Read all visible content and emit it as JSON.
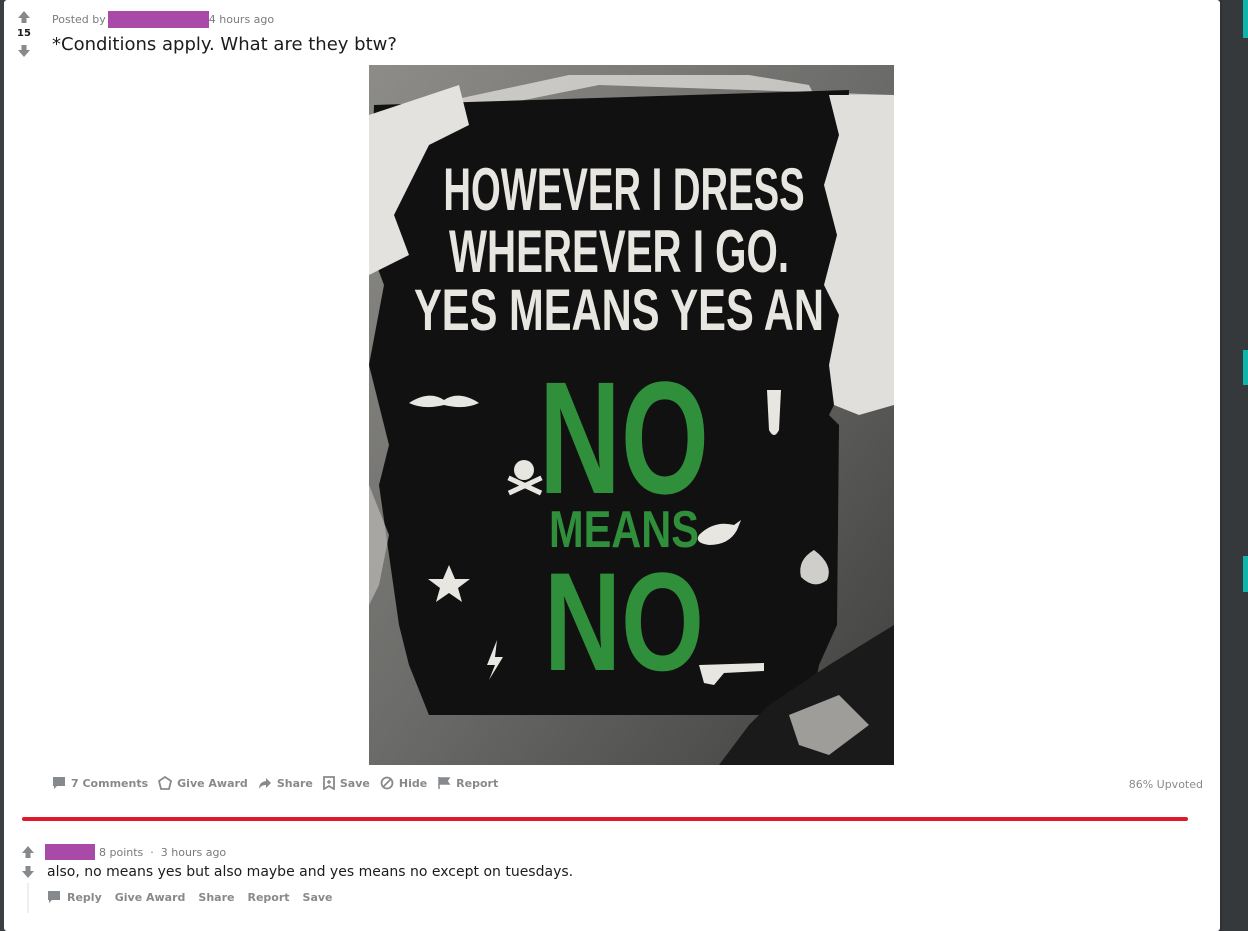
{
  "post": {
    "score": "15",
    "posted_by_prefix": "Posted by",
    "time": "4 hours ago",
    "title": "*Conditions apply. What are they btw?",
    "image": {
      "lines": [
        "HOWEVER I DRESS",
        "WHEREVER I GO.",
        "YES MEANS YES AN",
        "NO",
        "MEANS",
        "NO"
      ]
    },
    "actions": {
      "comments": "7 Comments",
      "give_award": "Give Award",
      "share": "Share",
      "save": "Save",
      "hide": "Hide",
      "report": "Report"
    },
    "upvoted": "86% Upvoted"
  },
  "comment": {
    "points": "8 points",
    "separator": "·",
    "time": "3 hours ago",
    "body": "also, no means yes but also maybe and yes means no except on tuesdays.",
    "actions": {
      "reply": "Reply",
      "give_award": "Give Award",
      "share": "Share",
      "report": "Report",
      "save": "Save"
    }
  },
  "colors": {
    "redaction": "#a94aa8",
    "separator_line": "#e0182b",
    "poster_green": "#2f8f3a",
    "teal_accent": "#0fb5aa"
  },
  "icons": [
    "upvote-icon",
    "downvote-icon",
    "comment-icon",
    "award-icon",
    "share-icon",
    "save-icon",
    "hide-icon",
    "report-icon"
  ]
}
